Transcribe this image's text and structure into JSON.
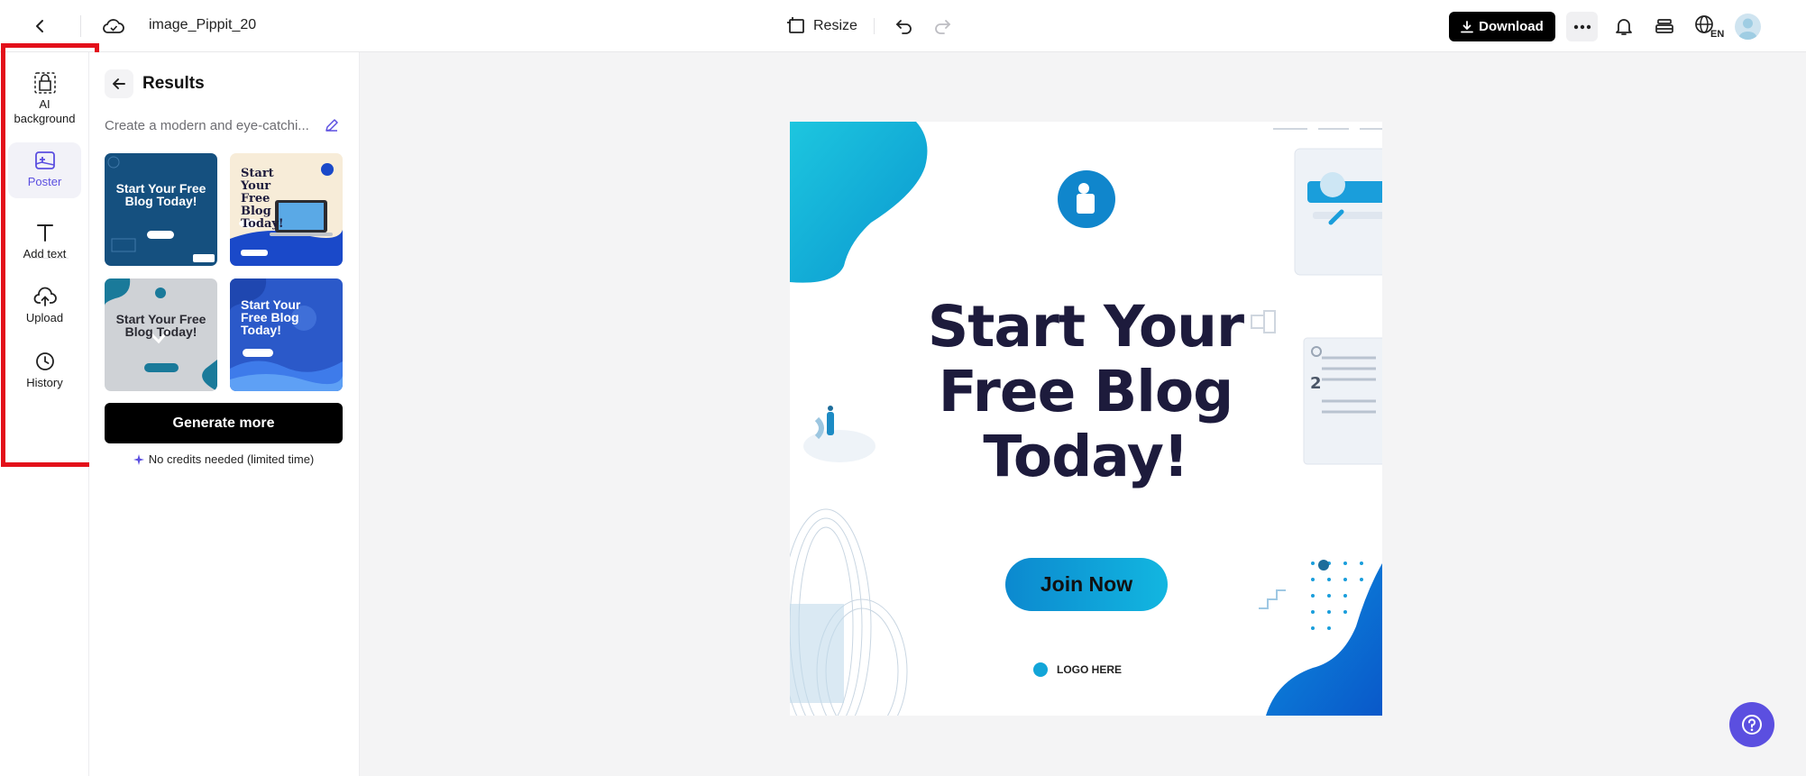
{
  "topbar": {
    "file_name": "image_Pippit_20",
    "resize_label": "Resize",
    "download_label": "Download",
    "language_code": "EN",
    "icons": [
      "back-icon",
      "cloud-save-icon",
      "resize-icon",
      "undo-icon",
      "redo-icon",
      "download-icon",
      "more-icon",
      "bell-icon",
      "layers-icon",
      "globe-icon"
    ]
  },
  "rail": {
    "items": [
      {
        "id": "ai-background",
        "label": "AI background",
        "icon": "ai-background-icon",
        "active": false
      },
      {
        "id": "poster",
        "label": "Poster",
        "icon": "poster-icon",
        "active": true
      },
      {
        "id": "add-text",
        "label": "Add text",
        "icon": "text-icon",
        "active": false
      },
      {
        "id": "upload",
        "label": "Upload",
        "icon": "upload-cloud-icon",
        "active": false
      },
      {
        "id": "history",
        "label": "History",
        "icon": "clock-icon",
        "active": false
      }
    ]
  },
  "panel": {
    "title": "Results",
    "prompt": "Create a modern and eye-catchi...",
    "thumbnails": [
      {
        "text": "Start Your Free Blog Today!",
        "style": "navy"
      },
      {
        "text": "Start Your Free Blog Today!",
        "style": "cream-laptop"
      },
      {
        "text": "Start Your Free Blog Today!",
        "style": "grey-selected"
      },
      {
        "text": "Start Your Free Blog Today!",
        "style": "blue-waves"
      }
    ],
    "generate_label": "Generate more",
    "credits_note": "No credits needed (limited time)"
  },
  "poster": {
    "title_line1": "Start Your",
    "title_line2": "Free Blog",
    "title_line3": "Today!",
    "button_label": "Join Now",
    "logo_text": "LOGO HERE"
  },
  "colors": {
    "accent": "#5b4fe0",
    "highlight": "#e3101a",
    "poster_blue": "#0c89cf",
    "poster_title": "#1d1b3c"
  }
}
